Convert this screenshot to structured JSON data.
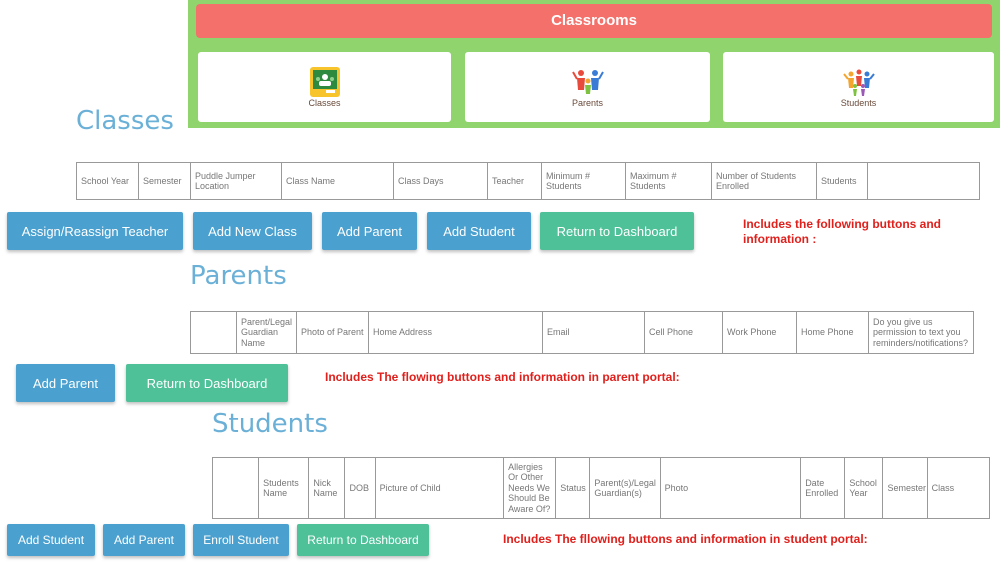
{
  "header": {
    "title": "Classrooms",
    "cards": [
      {
        "label": "Classes",
        "icon": "classroom-icon"
      },
      {
        "label": "Parents",
        "icon": "family-icon"
      },
      {
        "label": "Students",
        "icon": "students-icon"
      }
    ]
  },
  "classes": {
    "title": "Classes",
    "columns": [
      "School Year",
      "Semester",
      "Puddle Jumper Location",
      "Class Name",
      "Class Days",
      "Teacher",
      "Minimum # Students",
      "Maximum # Students",
      "Number of Students Enrolled",
      "Students",
      ""
    ],
    "buttons": [
      "Assign/Reassign Teacher",
      "Add New Class",
      "Add Parent",
      "Add Student",
      "Return to Dashboard"
    ],
    "note": "Includes the following buttons and information :"
  },
  "parents": {
    "title": "Parents",
    "columns": [
      "",
      "Parent/Legal Guardian Name",
      "Photo of Parent",
      "Home Address",
      "Email",
      "Cell Phone",
      "Work Phone",
      "Home Phone",
      "Do you give us permission to text you reminders/notifications?"
    ],
    "buttons": [
      "Add Parent",
      "Return to Dashboard"
    ],
    "note": "Includes The flowing buttons and information in parent portal:"
  },
  "students": {
    "title": "Students",
    "columns": [
      "",
      "Students Name",
      "Nick Name",
      "DOB",
      "Picture of Child",
      "Allergies Or Other Needs We Should Be Aware Of?",
      "Status",
      "Parent(s)/Legal Guardian(s)",
      "Photo",
      "Date Enrolled",
      "School Year",
      "Semester",
      "Class"
    ],
    "buttons": [
      "Add Student",
      "Add Parent",
      "Enroll Student",
      "Return to Dashboard"
    ],
    "note": "Includes The fllowing buttons and information in student portal:"
  },
  "colors": {
    "header": "#f4706b",
    "panel": "#8fd46c",
    "blue_button": "#4aa0cf",
    "green_button": "#4ec199",
    "title": "#6bb0d7",
    "note": "#e0201c"
  }
}
